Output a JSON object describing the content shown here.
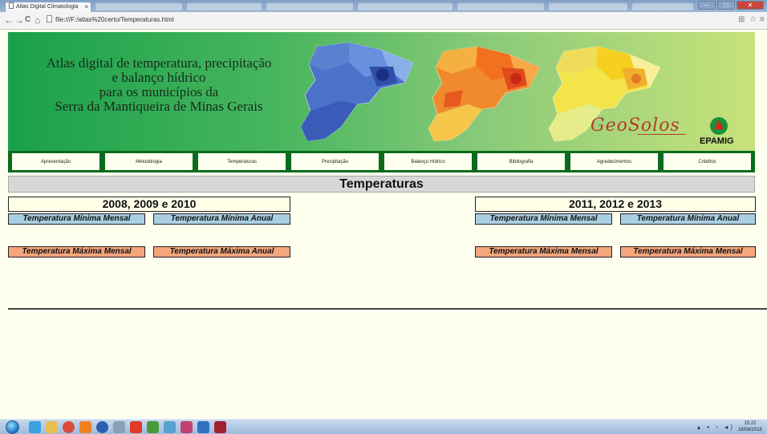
{
  "browser": {
    "tab_title": "Atlas Digital Climatologia",
    "tab_close": "×",
    "url": "file:///F:/atlas%20certo/Temperaturas.html",
    "nav_icons": [
      "back-arrow-icon",
      "forward-arrow-icon",
      "reload-icon",
      "home-icon"
    ],
    "nav_glyphs": {
      "back": "←",
      "forward": "→",
      "reload": "C",
      "home": "⌂"
    },
    "right_icons": {
      "translate": "⊞",
      "star": "☆",
      "menu": "≡"
    },
    "window_controls": {
      "minimize": "–",
      "maximize": "□",
      "close": "✕"
    }
  },
  "banner": {
    "title_lines": [
      "Atlas digital de temperatura, precipitação",
      "e balanço hídrico",
      "para os municípios da",
      "Serra da Mantiqueira de Minas Gerais"
    ],
    "geosolos_logo": "GeoSolos",
    "epamig_logo": "EPAMIG"
  },
  "nav": {
    "items": [
      "Apresentação",
      "Metodologia",
      "Temperaturas",
      "Precipitação",
      "Balanço Hídrico",
      "Bibliografia",
      "Agradecimentos",
      "Créditos"
    ]
  },
  "section": {
    "title": "Temperaturas"
  },
  "left_period": {
    "title": "2008, 2009 e 2010",
    "min_monthly": "Temperatura Mínima Mensal",
    "min_annual": "Temperatura Mínima Anual",
    "max_monthly": "Temperatura Máxima Mensal",
    "max_annual": "Temperatura Máxima Anual"
  },
  "right_period": {
    "title": "2011, 2012 e 2013",
    "min_monthly": "Temperatura Mínima Mensal",
    "min_annual": "Temperatura Mínima Anual",
    "max_monthly": "Temperatura Máxima Mensal",
    "max_annual": "Temperatura Máxima Mensal"
  },
  "colors": {
    "min_button": "#a9cfe2",
    "max_button": "#f3a57c",
    "nav_border": "#0b6b1d",
    "page_background": "#fffff0"
  },
  "taskbar": {
    "clock_time": "15:22",
    "clock_date": "16/06/2015"
  }
}
